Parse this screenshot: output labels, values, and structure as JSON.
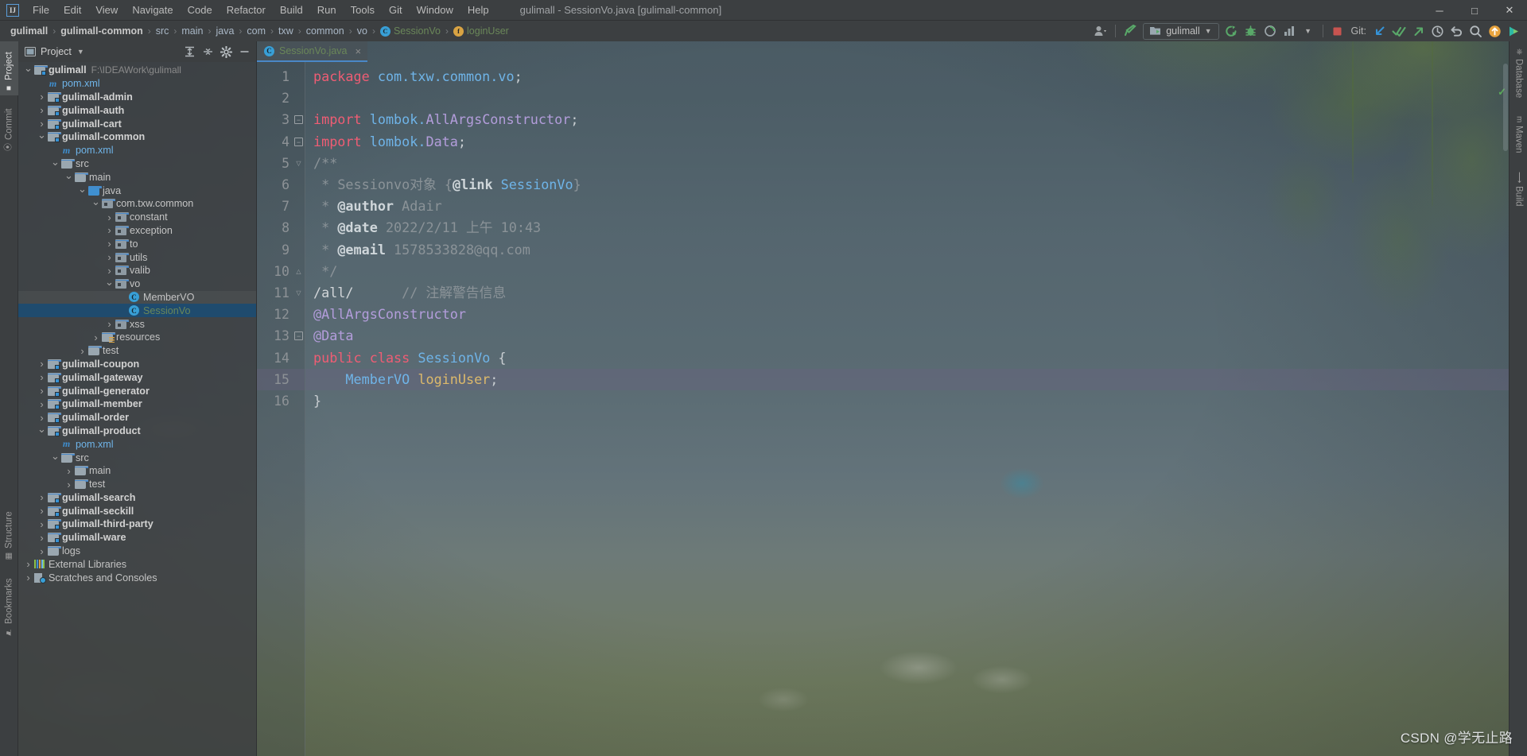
{
  "window": {
    "title": "gulimall - SessionVo.java [gulimall-common]",
    "logo": "IJ",
    "controls": [
      {
        "name": "minimize-button",
        "glyph": "─"
      },
      {
        "name": "maximize-button",
        "glyph": "☐"
      },
      {
        "name": "close-button",
        "glyph": "✕"
      }
    ]
  },
  "menu": [
    {
      "label": "File"
    },
    {
      "label": "Edit"
    },
    {
      "label": "View"
    },
    {
      "label": "Navigate"
    },
    {
      "label": "Code"
    },
    {
      "label": "Refactor"
    },
    {
      "label": "Build"
    },
    {
      "label": "Run"
    },
    {
      "label": "Tools"
    },
    {
      "label": "Git"
    },
    {
      "label": "Window"
    },
    {
      "label": "Help"
    }
  ],
  "breadcrumb": [
    {
      "label": "gulimall",
      "style": "bold"
    },
    {
      "label": "gulimall-common",
      "style": "bold"
    },
    {
      "label": "src",
      "style": "plain"
    },
    {
      "label": "main",
      "style": "plain"
    },
    {
      "label": "java",
      "style": "plain"
    },
    {
      "label": "com",
      "style": "plain"
    },
    {
      "label": "txw",
      "style": "plain"
    },
    {
      "label": "common",
      "style": "plain"
    },
    {
      "label": "vo",
      "style": "plain"
    },
    {
      "label": "SessionVo",
      "style": "green",
      "icon": "class-icon",
      "icon_char": "C"
    },
    {
      "label": "loginUser",
      "style": "green",
      "icon": "field-icon",
      "icon_char": "f"
    }
  ],
  "toolbar": {
    "run_config": "gulimall",
    "git_label": "Git:",
    "icons": [
      {
        "name": "user-avatar-icon"
      },
      {
        "name": "build-hammer-icon"
      },
      {
        "name": "run-config-selector"
      },
      {
        "name": "run-button-icon"
      },
      {
        "name": "debug-button-icon"
      },
      {
        "name": "run-with-coverage-icon"
      },
      {
        "name": "profile-icon"
      },
      {
        "name": "more-run-options-icon"
      },
      {
        "name": "stop-button-icon"
      },
      {
        "name": "git-update-icon"
      },
      {
        "name": "git-commit-icon"
      },
      {
        "name": "git-push-icon"
      },
      {
        "name": "git-history-icon"
      },
      {
        "name": "git-rollback-icon"
      },
      {
        "name": "search-everywhere-icon"
      },
      {
        "name": "notifications-icon"
      },
      {
        "name": "ide-assistant-icon"
      }
    ]
  },
  "left_stripe": [
    {
      "label": "Project",
      "selected": true,
      "icon": "project-icon"
    },
    {
      "label": "Commit",
      "selected": false,
      "icon": "commit-icon"
    },
    {
      "label": "Structure",
      "selected": false,
      "icon": "structure-icon"
    },
    {
      "label": "Bookmarks",
      "selected": false,
      "icon": "bookmarks-icon"
    }
  ],
  "right_stripe": [
    {
      "label": "Database",
      "icon": "database-icon"
    },
    {
      "label": "Maven",
      "icon": "maven-icon"
    },
    {
      "label": "Build",
      "icon": "build-icon"
    }
  ],
  "project_panel": {
    "title": "Project",
    "actions": [
      {
        "name": "expand-all-icon"
      },
      {
        "name": "collapse-all-icon"
      },
      {
        "name": "settings-gear-icon"
      },
      {
        "name": "hide-panel-icon"
      }
    ],
    "tree": [
      {
        "label": "gulimall",
        "suffix": "F:\\IDEAWork\\gulimall",
        "indent": 0,
        "arrow": "v",
        "icon": "module-folder",
        "bold": true
      },
      {
        "label": "pom.xml",
        "indent": 1,
        "arrow": "",
        "icon": "maven-file"
      },
      {
        "label": "gulimall-admin",
        "indent": 1,
        "arrow": ">",
        "icon": "module-folder",
        "bold": true
      },
      {
        "label": "gulimall-auth",
        "indent": 1,
        "arrow": ">",
        "icon": "module-folder",
        "bold": true
      },
      {
        "label": "gulimall-cart",
        "indent": 1,
        "arrow": ">",
        "icon": "module-folder",
        "bold": true
      },
      {
        "label": "gulimall-common",
        "indent": 1,
        "arrow": "v",
        "icon": "module-folder",
        "bold": true
      },
      {
        "label": "pom.xml",
        "indent": 2,
        "arrow": "",
        "icon": "maven-file"
      },
      {
        "label": "src",
        "indent": 2,
        "arrow": "v",
        "icon": "plain-folder"
      },
      {
        "label": "main",
        "indent": 3,
        "arrow": "v",
        "icon": "plain-folder"
      },
      {
        "label": "java",
        "indent": 4,
        "arrow": "v",
        "icon": "source-folder"
      },
      {
        "label": "com.txw.common",
        "indent": 5,
        "arrow": "v",
        "icon": "package-folder"
      },
      {
        "label": "constant",
        "indent": 6,
        "arrow": ">",
        "icon": "package-folder"
      },
      {
        "label": "exception",
        "indent": 6,
        "arrow": ">",
        "icon": "package-folder"
      },
      {
        "label": "to",
        "indent": 6,
        "arrow": ">",
        "icon": "package-folder"
      },
      {
        "label": "utils",
        "indent": 6,
        "arrow": ">",
        "icon": "package-folder"
      },
      {
        "label": "valib",
        "indent": 6,
        "arrow": ">",
        "icon": "package-folder"
      },
      {
        "label": "vo",
        "indent": 6,
        "arrow": "v",
        "icon": "package-folder"
      },
      {
        "label": "MemberVO",
        "indent": 7,
        "arrow": "",
        "icon": "java-class",
        "hover": true
      },
      {
        "label": "SessionVo",
        "indent": 7,
        "arrow": "",
        "icon": "java-class",
        "selected": true,
        "green": true
      },
      {
        "label": "xss",
        "indent": 6,
        "arrow": ">",
        "icon": "package-folder"
      },
      {
        "label": "resources",
        "indent": 5,
        "arrow": ">",
        "icon": "resources-folder"
      },
      {
        "label": "test",
        "indent": 4,
        "arrow": ">",
        "icon": "plain-folder"
      },
      {
        "label": "gulimall-coupon",
        "indent": 1,
        "arrow": ">",
        "icon": "module-folder",
        "bold": true
      },
      {
        "label": "gulimall-gateway",
        "indent": 1,
        "arrow": ">",
        "icon": "module-folder",
        "bold": true
      },
      {
        "label": "gulimall-generator",
        "indent": 1,
        "arrow": ">",
        "icon": "module-folder",
        "bold": true
      },
      {
        "label": "gulimall-member",
        "indent": 1,
        "arrow": ">",
        "icon": "module-folder",
        "bold": true
      },
      {
        "label": "gulimall-order",
        "indent": 1,
        "arrow": ">",
        "icon": "module-folder",
        "bold": true
      },
      {
        "label": "gulimall-product",
        "indent": 1,
        "arrow": "v",
        "icon": "module-folder",
        "bold": true
      },
      {
        "label": "pom.xml",
        "indent": 2,
        "arrow": "",
        "icon": "maven-file"
      },
      {
        "label": "src",
        "indent": 2,
        "arrow": "v",
        "icon": "plain-folder"
      },
      {
        "label": "main",
        "indent": 3,
        "arrow": ">",
        "icon": "plain-folder"
      },
      {
        "label": "test",
        "indent": 3,
        "arrow": ">",
        "icon": "plain-folder"
      },
      {
        "label": "gulimall-search",
        "indent": 1,
        "arrow": ">",
        "icon": "module-folder",
        "bold": true
      },
      {
        "label": "gulimall-seckill",
        "indent": 1,
        "arrow": ">",
        "icon": "module-folder",
        "bold": true
      },
      {
        "label": "gulimall-third-party",
        "indent": 1,
        "arrow": ">",
        "icon": "module-folder",
        "bold": true
      },
      {
        "label": "gulimall-ware",
        "indent": 1,
        "arrow": ">",
        "icon": "module-folder",
        "bold": true
      },
      {
        "label": "logs",
        "indent": 1,
        "arrow": ">",
        "icon": "plain-folder"
      },
      {
        "label": "External Libraries",
        "indent": 0,
        "arrow": ">",
        "icon": "libraries"
      },
      {
        "label": "Scratches and Consoles",
        "indent": 0,
        "arrow": ">",
        "icon": "scratches"
      }
    ]
  },
  "editor": {
    "tab": {
      "label": "SessionVo.java",
      "icon": "java-class-icon",
      "close": "×"
    },
    "inspection_status": "✓",
    "caret_line": 15,
    "lines": [
      {
        "n": 1,
        "fold": "",
        "tokens": [
          {
            "t": "package",
            "c": "k"
          },
          {
            "t": " ",
            "c": "pn"
          },
          {
            "t": "com.txw.common.vo",
            "c": "pk"
          },
          {
            "t": ";",
            "c": "pn"
          }
        ]
      },
      {
        "n": 2,
        "fold": "",
        "tokens": []
      },
      {
        "n": 3,
        "fold": "box",
        "tokens": [
          {
            "t": "import",
            "c": "k"
          },
          {
            "t": " ",
            "c": "pn"
          },
          {
            "t": "lombok.",
            "c": "pk"
          },
          {
            "t": "AllArgsConstructor",
            "c": "an"
          },
          {
            "t": ";",
            "c": "pn"
          }
        ]
      },
      {
        "n": 4,
        "fold": "box",
        "tokens": [
          {
            "t": "import",
            "c": "k"
          },
          {
            "t": " ",
            "c": "pn"
          },
          {
            "t": "lombok.",
            "c": "pk"
          },
          {
            "t": "Data",
            "c": "an"
          },
          {
            "t": ";",
            "c": "pn"
          }
        ]
      },
      {
        "n": 5,
        "fold": "down",
        "tokens": [
          {
            "t": "/**",
            "c": "cm"
          }
        ]
      },
      {
        "n": 6,
        "fold": "",
        "tokens": [
          {
            "t": " * ",
            "c": "cm"
          },
          {
            "t": "Sessionvo对象 ",
            "c": "cm"
          },
          {
            "t": "{",
            "c": "cm"
          },
          {
            "t": "@link",
            "c": "cmb"
          },
          {
            "t": " ",
            "c": "cm"
          },
          {
            "t": "SessionVo",
            "c": "pk"
          },
          {
            "t": "}",
            "c": "cm"
          }
        ]
      },
      {
        "n": 7,
        "fold": "",
        "tokens": [
          {
            "t": " * ",
            "c": "cm"
          },
          {
            "t": "@author",
            "c": "cmb"
          },
          {
            "t": " Adair",
            "c": "cm"
          }
        ]
      },
      {
        "n": 8,
        "fold": "",
        "tokens": [
          {
            "t": " * ",
            "c": "cm"
          },
          {
            "t": "@date",
            "c": "cmb"
          },
          {
            "t": " 2022/2/11 上午 10:43",
            "c": "cm"
          }
        ]
      },
      {
        "n": 9,
        "fold": "",
        "tokens": [
          {
            "t": " * ",
            "c": "cm"
          },
          {
            "t": "@email",
            "c": "cmb"
          },
          {
            "t": " 1578533828@qq.com",
            "c": "cm"
          }
        ]
      },
      {
        "n": 10,
        "fold": "up",
        "tokens": [
          {
            "t": " */",
            "c": "cm"
          }
        ]
      },
      {
        "n": 11,
        "fold": "down",
        "tokens": [
          {
            "t": "/all/",
            "c": "cmw"
          },
          {
            "t": "      ",
            "c": "pn"
          },
          {
            "t": "// 注解警告信息",
            "c": "cm"
          }
        ]
      },
      {
        "n": 12,
        "fold": "",
        "tokens": [
          {
            "t": "@AllArgsConstructor",
            "c": "an"
          }
        ]
      },
      {
        "n": 13,
        "fold": "box",
        "tokens": [
          {
            "t": "@Data",
            "c": "an"
          }
        ]
      },
      {
        "n": 14,
        "fold": "",
        "tokens": [
          {
            "t": "public",
            "c": "k"
          },
          {
            "t": " ",
            "c": "pn"
          },
          {
            "t": "class",
            "c": "k"
          },
          {
            "t": " ",
            "c": "pn"
          },
          {
            "t": "SessionVo",
            "c": "ty"
          },
          {
            "t": " {",
            "c": "pn"
          }
        ]
      },
      {
        "n": 15,
        "fold": "",
        "tokens": [
          {
            "t": "    ",
            "c": "pn"
          },
          {
            "t": "MemberVO",
            "c": "ty"
          },
          {
            "t": " ",
            "c": "pn"
          },
          {
            "t": "loginUser",
            "c": "fl"
          },
          {
            "t": ";",
            "c": "pn"
          }
        ]
      },
      {
        "n": 16,
        "fold": "",
        "tokens": [
          {
            "t": "}",
            "c": "pn"
          }
        ]
      }
    ]
  },
  "watermark": "CSDN @学无止路",
  "colors": {
    "accent_blue": "#4a88c7",
    "selection": "#1f4b6e",
    "keyword": "#ef5d74",
    "class": "#6fb4e8",
    "annotation": "#b39ddb",
    "comment": "#8b9398",
    "field": "#dcb96b",
    "green_text": "#6a8759",
    "panel_bg": "#3c3f41"
  }
}
